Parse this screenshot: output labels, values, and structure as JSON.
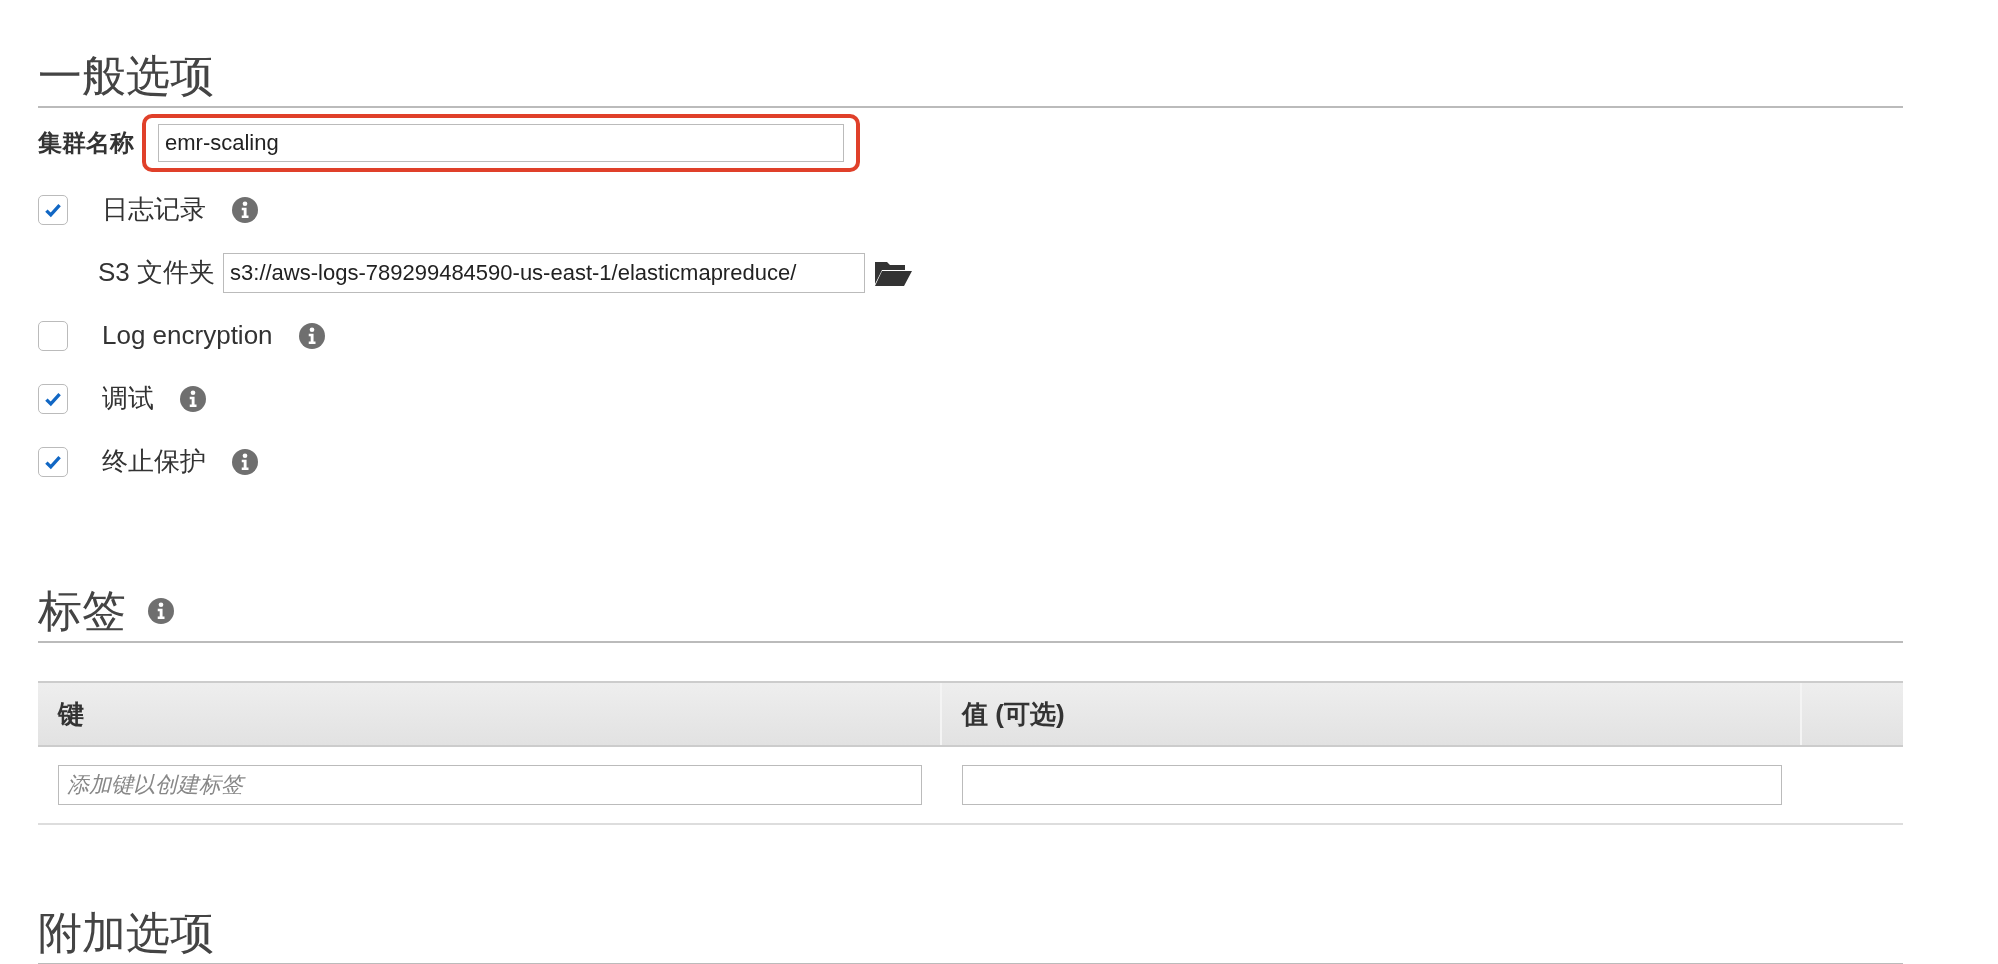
{
  "general": {
    "title": "一般选项",
    "name_field": {
      "label": "集群名称",
      "value": "emr-scaling",
      "highlighted": true
    },
    "options": [
      {
        "kind": "checkbox",
        "label": "日志记录",
        "checked": true
      },
      {
        "kind": "folder",
        "label": "S3 文件夹",
        "value": "s3://aws-logs-789299484590-us-east-1/elasticmapreduce/"
      },
      {
        "kind": "checkbox",
        "label": "Log encryption",
        "checked": false
      },
      {
        "kind": "checkbox",
        "label": "调试",
        "checked": true
      },
      {
        "kind": "checkbox",
        "label": "终止保护",
        "checked": true
      }
    ]
  },
  "tags": {
    "title": "标签",
    "columns": [
      "键",
      "值 (可选)"
    ],
    "row": {
      "key_placeholder": "添加键以创建标签"
    }
  },
  "additional": {
    "title": "附加选项"
  }
}
